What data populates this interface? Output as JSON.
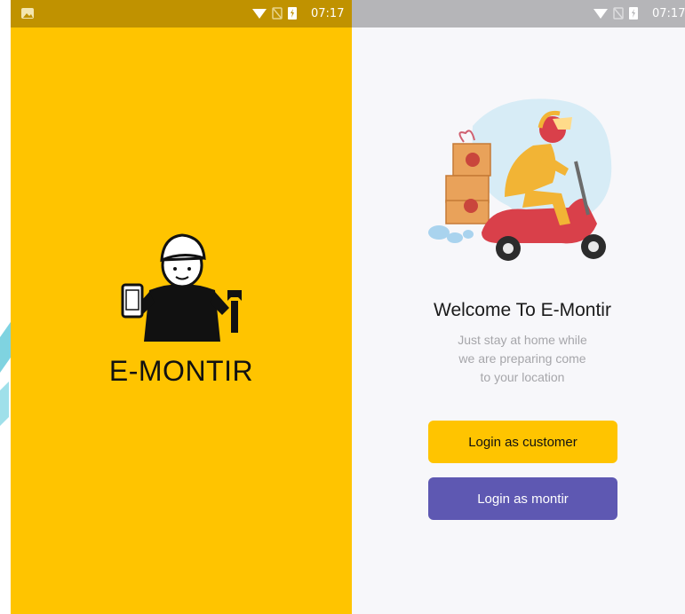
{
  "splash": {
    "status_bar": {
      "time": "07:17"
    },
    "brand_name": "E-MONTIR",
    "background_color": "#ffc400",
    "illustration_icon": "mechanic-holding-phone-and-wrench"
  },
  "welcome": {
    "status_bar": {
      "time": "07:17"
    },
    "illustration_icon": "scooter-delivery-rider",
    "title": "Welcome To E-Montir",
    "subtitle": "Just stay at home while\nwe are preparing come\nto your location",
    "login_customer_label": "Login as customer",
    "login_montir_label": "Login as montir",
    "colors": {
      "customer_button": "#ffc400",
      "montir_button": "#5e58b2"
    }
  }
}
